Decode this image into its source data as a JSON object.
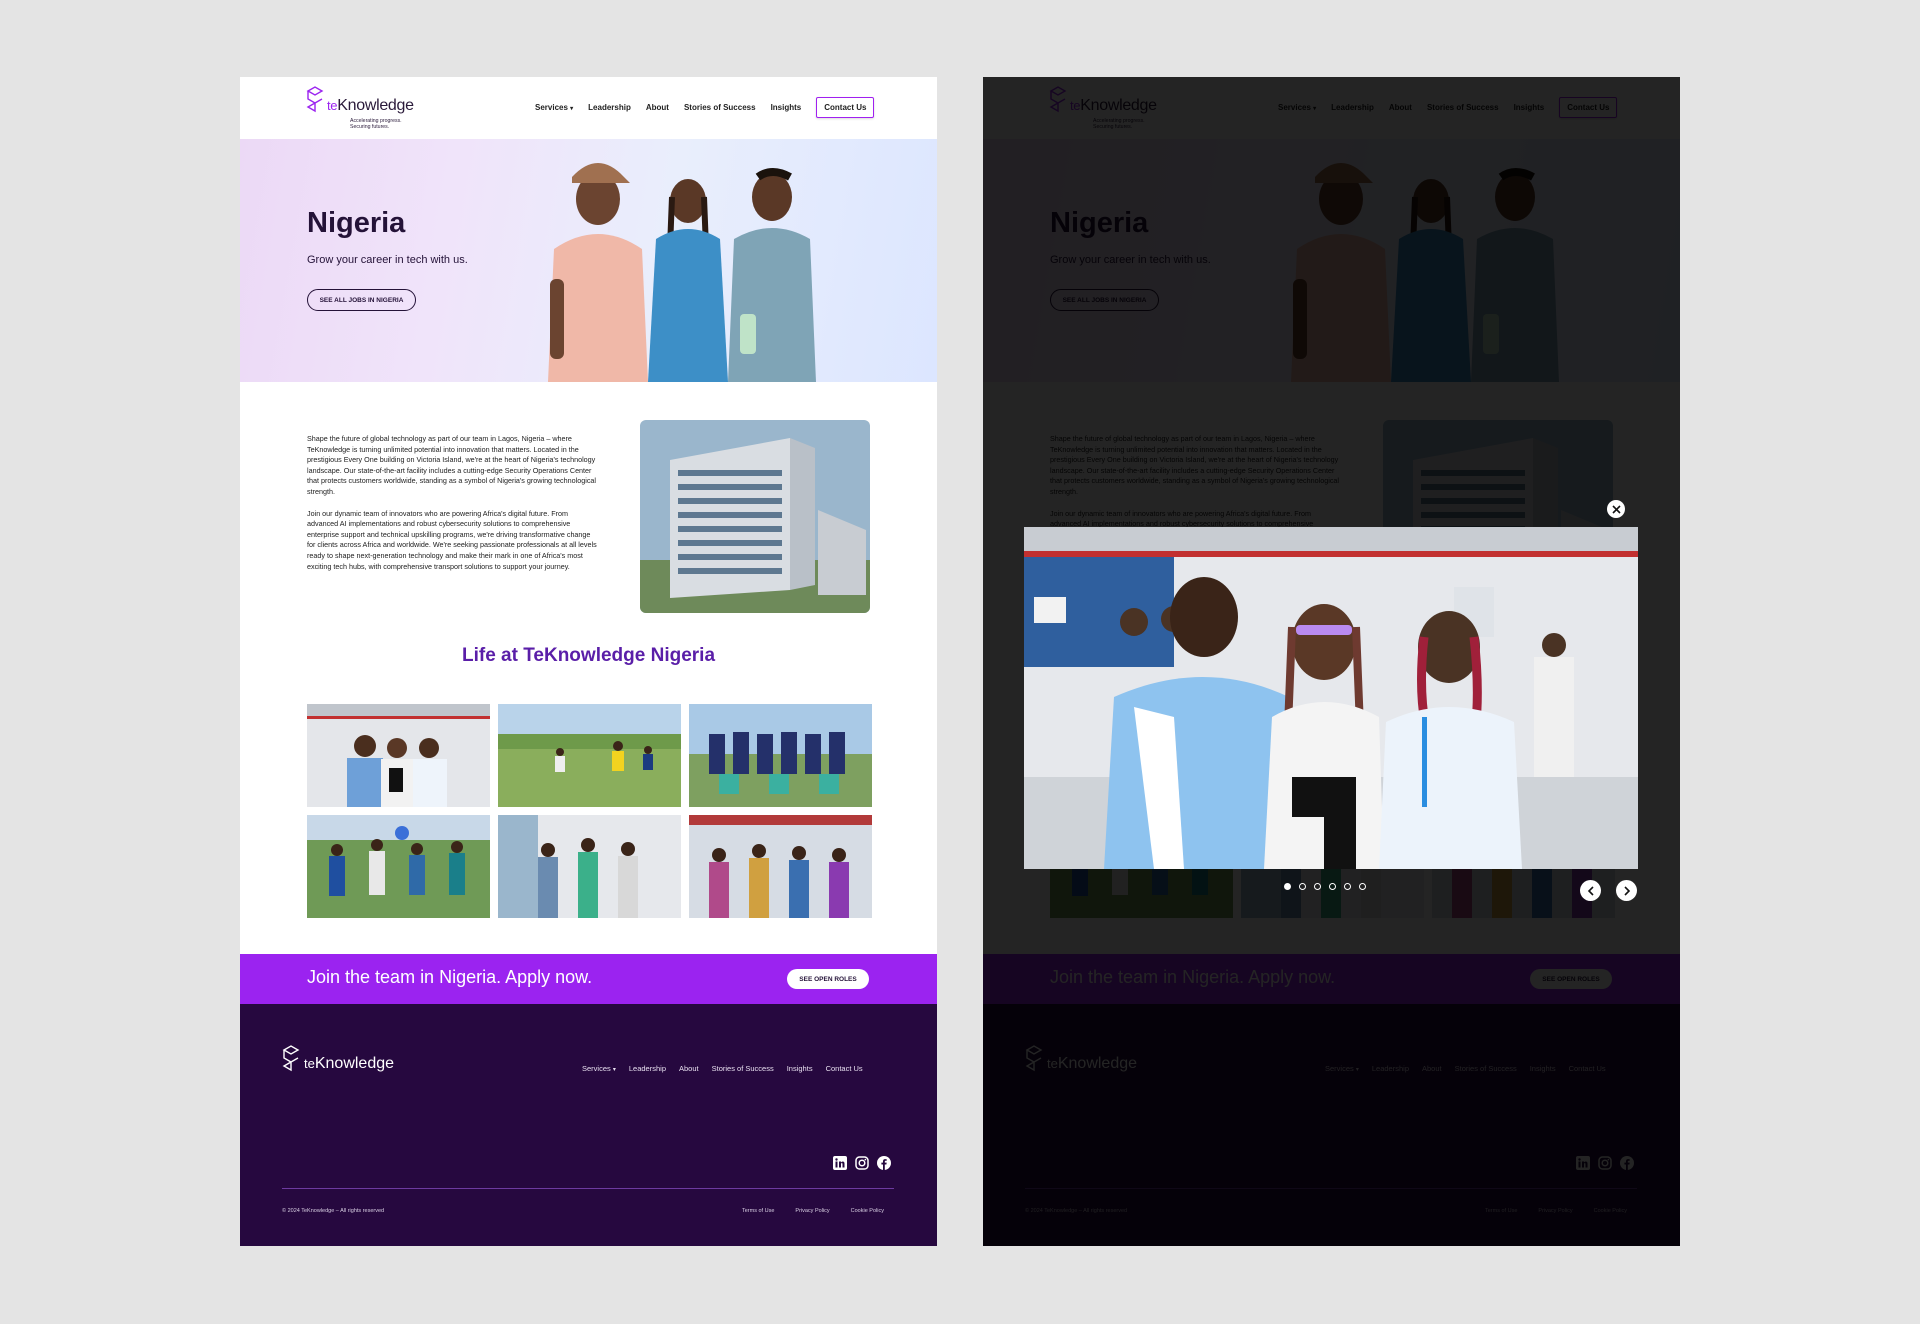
{
  "brand": {
    "logo_prefix": "te",
    "logo_name": "Knowledge",
    "tagline_1": "Accelerating progress.",
    "tagline_2": "Securing futures."
  },
  "nav": {
    "services": "Services",
    "leadership": "Leadership",
    "about": "About",
    "stories": "Stories of Success",
    "insights": "Insights",
    "contact": "Contact Us"
  },
  "hero": {
    "title": "Nigeria",
    "subtitle": "Grow your career in tech with us.",
    "cta": "SEE ALL JOBS IN NIGERIA"
  },
  "intro": {
    "p1": "Shape the future of global technology as part of our team in Lagos, Nigeria – where TeKnowledge is turning unlimited potential into innovation that matters. Located in the prestigious Every One building on Victoria Island, we're at the heart of Nigeria's technology landscape. Our state-of-the-art facility includes a cutting-edge Security Operations Center that protects customers worldwide, standing as a symbol of Nigeria's growing technological strength.",
    "p2": "Join our dynamic team of innovators who are powering Africa's digital future. From advanced AI implementations and robust cybersecurity solutions to comprehensive enterprise support and technical upskilling programs, we're driving transformative change for clients across Africa and worldwide. We're seeking passionate professionals at all levels ready to shape next-generation technology and make their mark in one of Africa's most exciting tech hubs, with comprehensive transport solutions to support your journey."
  },
  "life": {
    "title": "Life at TeKnowledge Nigeria"
  },
  "join": {
    "text": "Join the team in Nigeria. Apply now.",
    "cta": "SEE OPEN ROLES"
  },
  "footer": {
    "services": "Services",
    "leadership": "Leadership",
    "about": "About",
    "stories": "Stories of Success",
    "insights": "Insights",
    "contact": "Contact Us",
    "copyright": "© 2024 TeKnowledge – All rights reserved",
    "terms": "Terms of Use",
    "privacy": "Privacy Policy",
    "cookie": "Cookie Policy",
    "social": [
      "linkedin-icon",
      "instagram-icon",
      "facebook-icon"
    ]
  },
  "lightbox": {
    "slide_count": 6,
    "active_slide": 1
  },
  "colors": {
    "accent": "#9b23f0",
    "heading_purple": "#5a1ea8",
    "footer_bg": "#26083f",
    "dark_text": "#241238"
  }
}
